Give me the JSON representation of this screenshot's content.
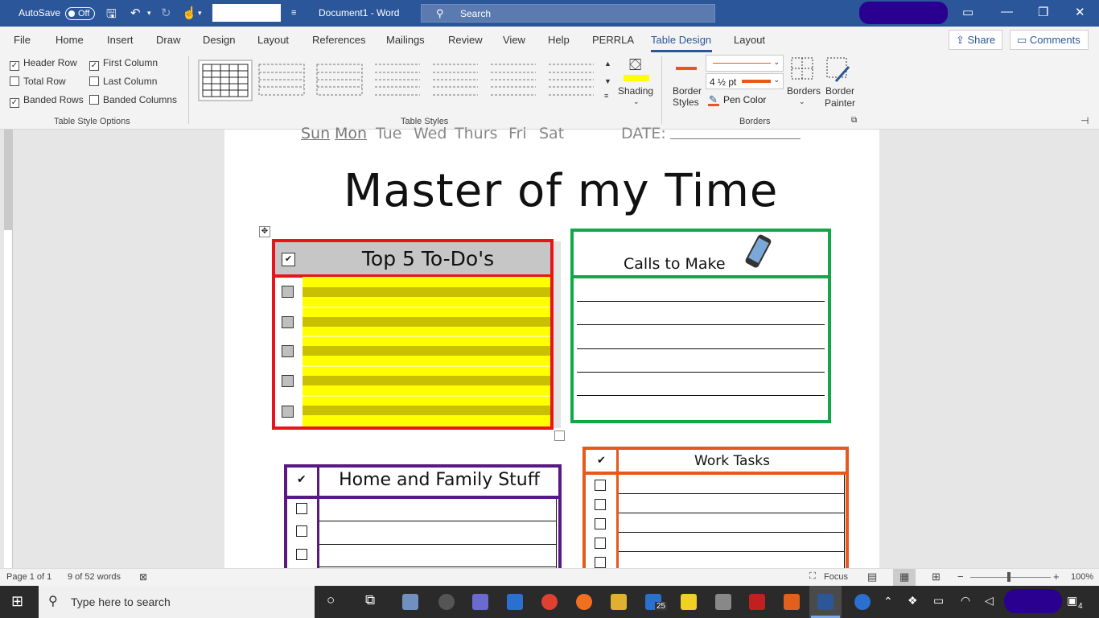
{
  "titlebar": {
    "autosave_label": "AutoSave",
    "autosave_state": "Off",
    "doc_title": "Document1  -  Word",
    "search_placeholder": "Search"
  },
  "tabs": [
    "File",
    "Home",
    "Insert",
    "Draw",
    "Design",
    "Layout",
    "References",
    "Mailings",
    "Review",
    "View",
    "Help",
    "PERRLA",
    "Table Design",
    "Layout"
  ],
  "active_tab": "Table Design",
  "share_label": "Share",
  "comments_label": "Comments",
  "table_style_options": {
    "items": [
      {
        "label": "Header Row",
        "checked": true
      },
      {
        "label": "First Column",
        "checked": true
      },
      {
        "label": "Total Row",
        "checked": false
      },
      {
        "label": "Last Column",
        "checked": false
      },
      {
        "label": "Banded Rows",
        "checked": true
      },
      {
        "label": "Banded Columns",
        "checked": false
      }
    ],
    "group_label": "Table Style Options"
  },
  "table_styles_label": "Table Styles",
  "shading_label": "Shading",
  "border_styles_label": "Border Styles",
  "pen_weight": "4 ½ pt",
  "pen_color_label": "Pen Color",
  "borders_label": "Borders",
  "border_painter_label": "Border Painter",
  "borders_group_label": "Borders",
  "document": {
    "days": [
      "Sun",
      "Mon",
      "Tue",
      "Wed",
      "Thurs",
      "Fri",
      "Sat"
    ],
    "date_label": "DATE:",
    "title": "Master of my Time",
    "todo_header": "Top 5 To-Do's",
    "calls_header": "Calls to Make",
    "home_header": "Home and Family Stuff",
    "work_header": "Work Tasks",
    "check_mark": "✔"
  },
  "statusbar": {
    "page": "Page 1 of 1",
    "words": "9 of 52 words",
    "focus": "Focus",
    "zoom": "100%"
  },
  "taskbar": {
    "search_placeholder": "Type here to search",
    "mail_badge": "25",
    "notification_count": "4"
  },
  "colors": {
    "accent": "#2b579a",
    "todo_border": "#e8141a",
    "calls_border": "#12a84a",
    "home_border": "#5a1882",
    "work_border": "#e8581a",
    "highlight_yellow": "#ffff00"
  }
}
